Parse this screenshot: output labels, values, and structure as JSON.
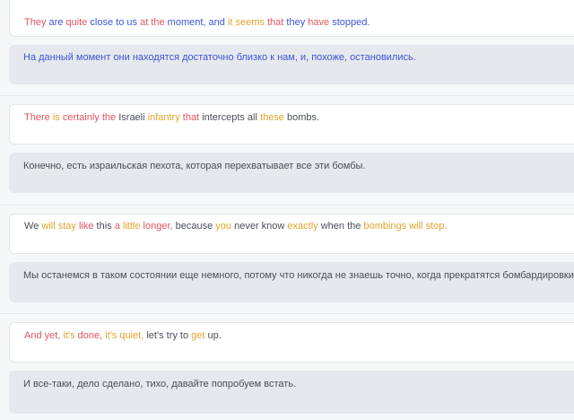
{
  "colors": {
    "red": "#e0555f",
    "orange": "#e0a42a",
    "blue": "#3c56d6",
    "dark": "#4a4f57"
  },
  "blocks": [
    {
      "english": [
        {
          "t": "They",
          "c": "red"
        },
        {
          "t": " ",
          "c": "dark"
        },
        {
          "t": "are",
          "c": "blue"
        },
        {
          "t": " ",
          "c": "dark"
        },
        {
          "t": "quite",
          "c": "red"
        },
        {
          "t": " ",
          "c": "dark"
        },
        {
          "t": "close to us",
          "c": "blue"
        },
        {
          "t": " ",
          "c": "dark"
        },
        {
          "t": "at the",
          "c": "red"
        },
        {
          "t": " ",
          "c": "dark"
        },
        {
          "t": "moment,",
          "c": "blue"
        },
        {
          "t": " ",
          "c": "dark"
        },
        {
          "t": "and",
          "c": "blue"
        },
        {
          "t": " ",
          "c": "dark"
        },
        {
          "t": "it seems",
          "c": "orange"
        },
        {
          "t": " ",
          "c": "dark"
        },
        {
          "t": "that",
          "c": "red"
        },
        {
          "t": " ",
          "c": "dark"
        },
        {
          "t": "they",
          "c": "blue"
        },
        {
          "t": " ",
          "c": "dark"
        },
        {
          "t": "have",
          "c": "red"
        },
        {
          "t": " ",
          "c": "dark"
        },
        {
          "t": "stopped.",
          "c": "blue"
        }
      ],
      "russian": "На данный момент они находятся достаточно близко к нам, и, похоже, остановились.",
      "russian_color": "blue"
    },
    {
      "english": [
        {
          "t": "There",
          "c": "red"
        },
        {
          "t": " ",
          "c": "dark"
        },
        {
          "t": "is",
          "c": "orange"
        },
        {
          "t": " ",
          "c": "dark"
        },
        {
          "t": "certainly",
          "c": "red"
        },
        {
          "t": " ",
          "c": "dark"
        },
        {
          "t": "the",
          "c": "red"
        },
        {
          "t": " ",
          "c": "dark"
        },
        {
          "t": "Israeli",
          "c": "dark"
        },
        {
          "t": " ",
          "c": "dark"
        },
        {
          "t": "infantry",
          "c": "orange"
        },
        {
          "t": " ",
          "c": "dark"
        },
        {
          "t": "that",
          "c": "red"
        },
        {
          "t": " ",
          "c": "dark"
        },
        {
          "t": "intercepts all",
          "c": "dark"
        },
        {
          "t": " ",
          "c": "dark"
        },
        {
          "t": "these",
          "c": "orange"
        },
        {
          "t": " ",
          "c": "dark"
        },
        {
          "t": "bombs.",
          "c": "dark"
        }
      ],
      "russian": "Конечно, есть израильская пехота, которая перехватывает все эти бомбы.",
      "russian_color": "dark"
    },
    {
      "english": [
        {
          "t": "We",
          "c": "dark"
        },
        {
          "t": " ",
          "c": "dark"
        },
        {
          "t": "will stay",
          "c": "orange"
        },
        {
          "t": " ",
          "c": "dark"
        },
        {
          "t": "like",
          "c": "red"
        },
        {
          "t": " ",
          "c": "dark"
        },
        {
          "t": "this",
          "c": "dark"
        },
        {
          "t": " ",
          "c": "dark"
        },
        {
          "t": "a",
          "c": "red"
        },
        {
          "t": " ",
          "c": "dark"
        },
        {
          "t": "little",
          "c": "orange"
        },
        {
          "t": " ",
          "c": "dark"
        },
        {
          "t": "longer,",
          "c": "red"
        },
        {
          "t": " ",
          "c": "dark"
        },
        {
          "t": "because",
          "c": "dark"
        },
        {
          "t": " ",
          "c": "dark"
        },
        {
          "t": "you",
          "c": "orange"
        },
        {
          "t": " ",
          "c": "dark"
        },
        {
          "t": "never know",
          "c": "dark"
        },
        {
          "t": " ",
          "c": "dark"
        },
        {
          "t": "exactly",
          "c": "orange"
        },
        {
          "t": " ",
          "c": "dark"
        },
        {
          "t": "when the",
          "c": "dark"
        },
        {
          "t": " ",
          "c": "dark"
        },
        {
          "t": "bombings",
          "c": "orange"
        },
        {
          "t": " ",
          "c": "dark"
        },
        {
          "t": "will stop.",
          "c": "orange"
        }
      ],
      "russian": "Мы останемся в таком состоянии еще немного, потому что никогда не знаешь точно, когда прекратятся бомбардировки.",
      "russian_color": "dark"
    },
    {
      "english": [
        {
          "t": "And",
          "c": "red"
        },
        {
          "t": " ",
          "c": "dark"
        },
        {
          "t": "yet,",
          "c": "red"
        },
        {
          "t": " ",
          "c": "dark"
        },
        {
          "t": "it's",
          "c": "orange"
        },
        {
          "t": " ",
          "c": "dark"
        },
        {
          "t": "done,",
          "c": "red"
        },
        {
          "t": " ",
          "c": "dark"
        },
        {
          "t": "it's",
          "c": "orange"
        },
        {
          "t": " ",
          "c": "dark"
        },
        {
          "t": "quiet,",
          "c": "orange"
        },
        {
          "t": " ",
          "c": "dark"
        },
        {
          "t": "let's try to",
          "c": "dark"
        },
        {
          "t": " ",
          "c": "dark"
        },
        {
          "t": "get",
          "c": "orange"
        },
        {
          "t": " ",
          "c": "dark"
        },
        {
          "t": "up.",
          "c": "dark"
        }
      ],
      "russian": "И все-таки, дело сделано, тихо, давайте попробуем встать.",
      "russian_color": "dark"
    }
  ]
}
